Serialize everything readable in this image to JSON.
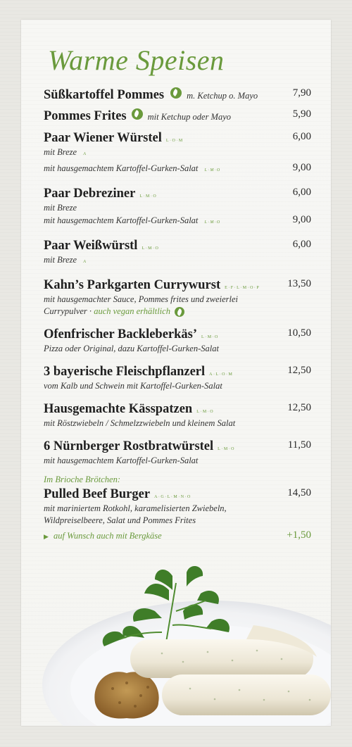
{
  "title": "Warme Speisen",
  "items": [
    {
      "name": "Süßkartoffel Pommes",
      "note": "m. Ketchup o. Mayo",
      "price": "7,90"
    },
    {
      "name": "Pommes Frites",
      "note": "mit Ketchup oder Mayo",
      "price": "5,90"
    },
    {
      "name": "Paar Wiener Würstel",
      "codes": "L·O·M",
      "price": "6,00",
      "sub1": "mit Breze",
      "sub1_codes": "A",
      "sub2": "mit hausgemachtem Kartoffel-Gurken-Salat",
      "sub2_codes": "L·M·O",
      "sub2_price": "9,00"
    },
    {
      "name": "Paar Debreziner",
      "codes": "L·M·O",
      "price": "6,00",
      "sub1": "mit Breze",
      "sub2": "mit hausgemachtem Kartoffel-Gurken-Salat",
      "sub2_codes": "L·M·O",
      "sub2_price": "9,00"
    },
    {
      "name": "Paar Weißwürstl",
      "codes": "L·M·O",
      "price": "6,00",
      "sub1": "mit Breze",
      "sub1_codes": "A"
    },
    {
      "name": "Kahn’s Parkgarten Currywurst",
      "codes": "E·F·L·M·O·P",
      "price": "13,50",
      "sub1": "mit hausgemachter Sauce, Pommes frites und zweierlei",
      "sub2": "Currypulver ·",
      "sub2_green": "auch vegan erhältlich"
    },
    {
      "name": "Ofenfrischer Backleberkäs’",
      "codes": "L·M·O",
      "price": "10,50",
      "sub1": "Pizza oder Original, dazu Kartoffel-Gurken-Salat"
    },
    {
      "name": "3 bayerische Fleischpflanzerl",
      "codes": "A·L·O·M",
      "price": "12,50",
      "sub1": "vom Kalb und  Schwein mit Kartoffel-Gurken-Salat"
    },
    {
      "name": "Hausgemachte Kässpatzen",
      "codes": "L·M·O",
      "price": "12,50",
      "sub1": "mit Röstzwiebeln / Schmelzzwiebeln und kleinem Salat"
    },
    {
      "name": "6 Nürnberger Rostbratwürstel",
      "codes": "L·M·O",
      "price": "11,50",
      "sub1": "mit hausgemachtem Kartoffel-Gurken-Salat"
    },
    {
      "pre": "Im Brioche Brötchen:",
      "name": "Pulled Beef Burger",
      "codes": "A·G·L·M·N·O",
      "price": "14,50",
      "sub1": "mit mariniertem Rotkohl, karamelisierten Zwiebeln,",
      "sub2": "Wildpreiselbeere, Salat und Pommes Frites",
      "sub3_green": "auf Wunsch auch mit Bergkäse",
      "sub3_price": "+1,50"
    }
  ],
  "colors": {
    "accent": "#6a9a3c",
    "text": "#1f1f1f",
    "background": "#f5f5f2"
  },
  "icons": {
    "vegan": "leaf-icon",
    "arrow": "triangle-right-icon"
  }
}
